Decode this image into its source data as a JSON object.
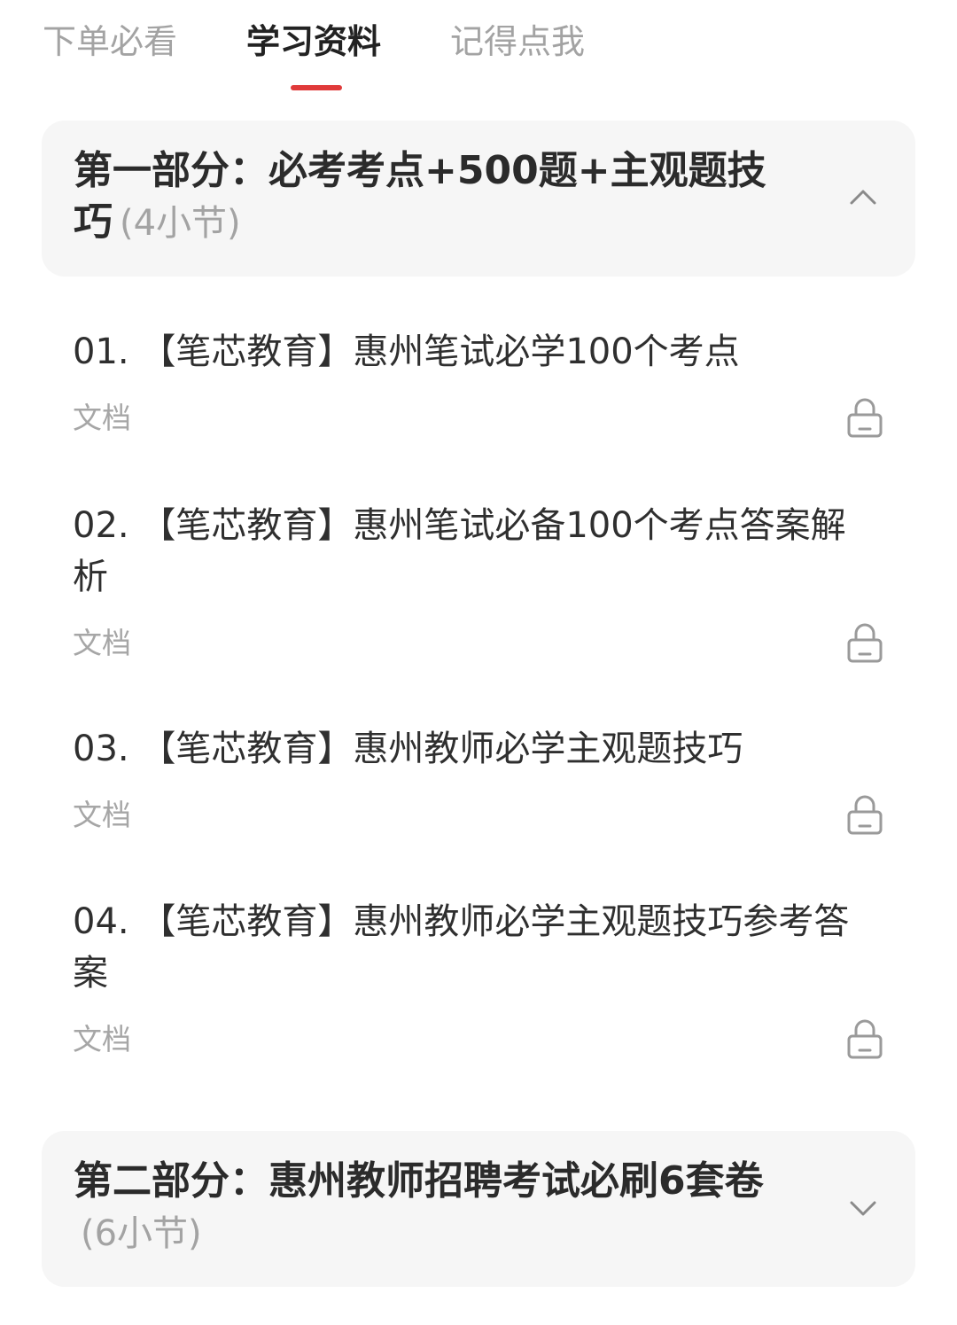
{
  "tabs": [
    {
      "label": "下单必看",
      "active": false
    },
    {
      "label": "学习资料",
      "active": true
    },
    {
      "label": "记得点我",
      "active": false
    }
  ],
  "colors": {
    "accent": "#e03a3a",
    "card_bg": "#f6f6f6",
    "muted_text": "#a6a6a6"
  },
  "sections": [
    {
      "title": "第一部分：必考考点+500题+主观题技巧",
      "count": "(4小节)",
      "expanded": true,
      "chevron_icon": "chevron-up-icon"
    },
    {
      "title": "第二部分：惠州教师招聘考试必刷6套卷",
      "count": "(6小节)",
      "expanded": false,
      "chevron_icon": "chevron-down-icon"
    }
  ],
  "items": [
    {
      "title": "01. 【笔芯教育】惠州笔试必学100个考点",
      "type": "文档",
      "icon": "lock-icon"
    },
    {
      "title": "02. 【笔芯教育】惠州笔试必备100个考点答案解析",
      "type": "文档",
      "icon": "lock-icon"
    },
    {
      "title": "03. 【笔芯教育】惠州教师必学主观题技巧",
      "type": "文档",
      "icon": "lock-icon"
    },
    {
      "title": "04. 【笔芯教育】惠州教师必学主观题技巧参考答案",
      "type": "文档",
      "icon": "lock-icon"
    }
  ]
}
